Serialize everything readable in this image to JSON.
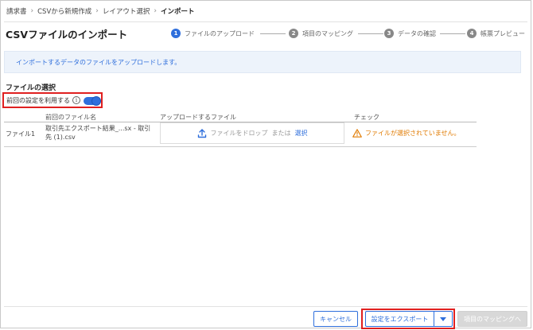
{
  "breadcrumb": {
    "items": [
      "請求書",
      "CSVから新規作成",
      "レイアウト選択"
    ],
    "current": "インポート",
    "separator": "›"
  },
  "page": {
    "title": "CSVファイルのインポート"
  },
  "stepper": {
    "steps": [
      {
        "number": "1",
        "label": "ファイルのアップロード",
        "active": true
      },
      {
        "number": "2",
        "label": "項目のマッピング",
        "active": false
      },
      {
        "number": "3",
        "label": "データの確認",
        "active": false
      },
      {
        "number": "4",
        "label": "帳票プレビュー",
        "active": false
      }
    ]
  },
  "info": {
    "message": "インポートするデータのファイルをアップロードします。"
  },
  "file_selection": {
    "section_title": "ファイルの選択",
    "use_previous_label": "前回の設定を利用する",
    "info_icon": "i",
    "use_previous_enabled": true
  },
  "table": {
    "headers": {
      "previous_file": "前回のファイル名",
      "upload_file": "アップロードするファイル",
      "check": "チェック"
    },
    "rows": [
      {
        "file_label": "ファイル1",
        "previous_line1": "取引先エクスポート結果_...sx - 取引",
        "previous_line2": "先 (1).csv",
        "drop_text": "ファイルをドロップ",
        "or_text": "または",
        "select_link": "選択",
        "check_message": "ファイルが選択されていません。"
      }
    ]
  },
  "footer": {
    "cancel_label": "キャンセル",
    "export_label": "設定をエクスポート",
    "next_label": "項目のマッピングへ"
  },
  "colors": {
    "accent": "#2f6fdc",
    "warning": "#e07a00",
    "highlight": "#e02020"
  }
}
